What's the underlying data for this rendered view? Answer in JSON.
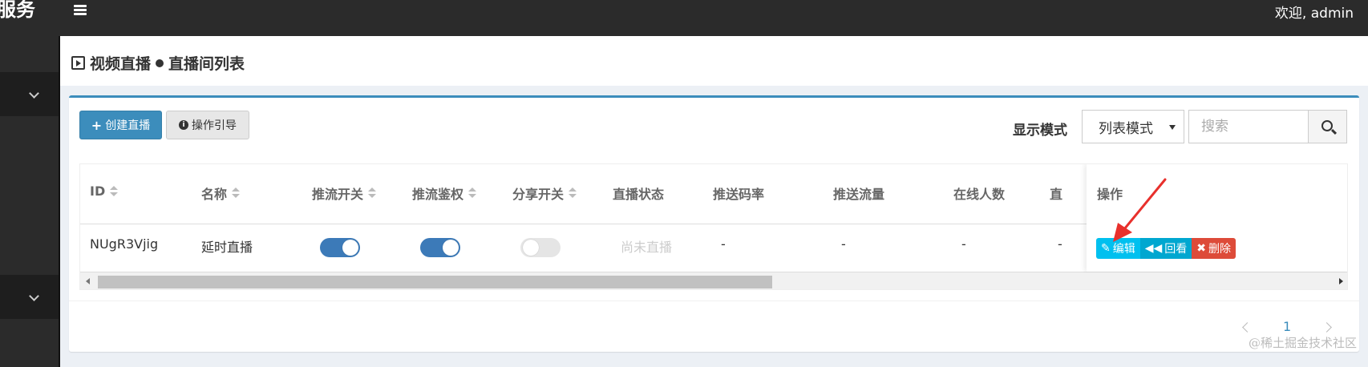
{
  "header": {
    "brand": "服务",
    "welcome": "欢迎, admin"
  },
  "page": {
    "breadcrumb_parent": "视频直播",
    "breadcrumb_current": "直播间列表"
  },
  "toolbar": {
    "create_label": "创建直播",
    "guide_label": "操作引导",
    "mode_label": "显示模式",
    "mode_value": "列表模式",
    "search_placeholder": "搜索"
  },
  "table": {
    "columns": [
      "ID",
      "名称",
      "推流开关",
      "推流鉴权",
      "分享开关",
      "直播状态",
      "推送码率",
      "推送流量",
      "在线人数",
      "直",
      "操作"
    ],
    "rows": [
      {
        "id": "NUgR3Vjig",
        "name": "延时直播",
        "push_switch": true,
        "push_auth": true,
        "share_switch": false,
        "status": "尚未直播",
        "bitrate": "-",
        "traffic": "-",
        "online": "-",
        "extra": "-"
      }
    ],
    "actions": {
      "edit": "编辑",
      "replay": "回看",
      "delete": "删除"
    }
  },
  "pagination": {
    "current_page": "1"
  },
  "watermark": "@稀土掘金技术社区",
  "colors": {
    "primary": "#3c8dbc",
    "edit": "#00c0ef",
    "replay": "#00a7d0",
    "delete": "#dd4b39",
    "annotation_arrow": "#e8302c"
  }
}
